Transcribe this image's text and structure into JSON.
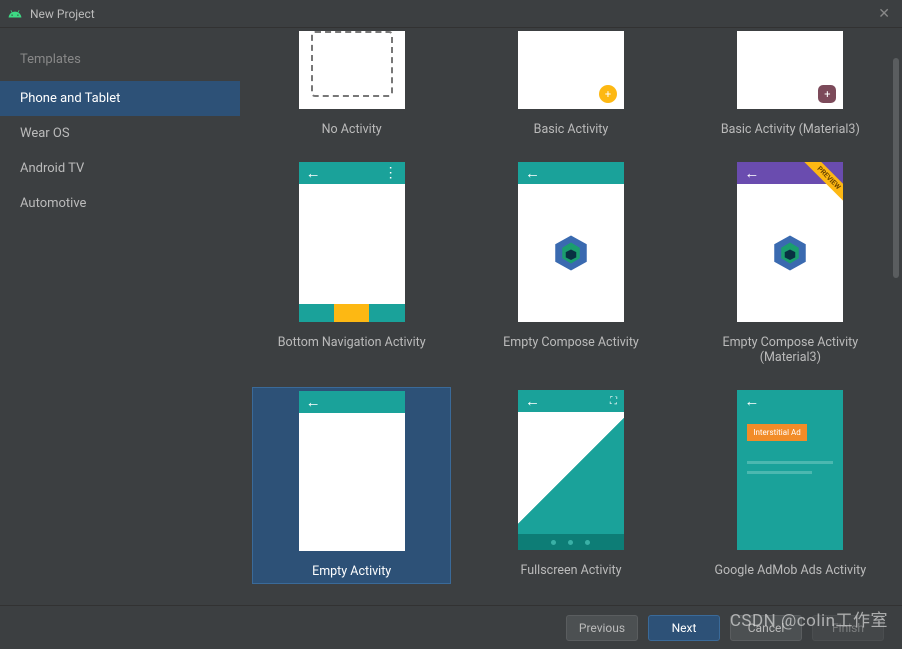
{
  "window": {
    "title": "New Project"
  },
  "sidebar": {
    "header": "Templates",
    "items": [
      {
        "label": "Phone and Tablet",
        "selected": true
      },
      {
        "label": "Wear OS",
        "selected": false
      },
      {
        "label": "Android TV",
        "selected": false
      },
      {
        "label": "Automotive",
        "selected": false
      }
    ]
  },
  "templates": {
    "row0": [
      {
        "label": "No Activity"
      },
      {
        "label": "Basic Activity"
      },
      {
        "label": "Basic Activity (Material3)"
      }
    ],
    "row1": [
      {
        "label": "Bottom Navigation Activity"
      },
      {
        "label": "Empty Compose Activity"
      },
      {
        "label": "Empty Compose Activity (Material3)",
        "ribbon": "PREVIEW"
      }
    ],
    "row2": [
      {
        "label": "Empty Activity",
        "selected": true
      },
      {
        "label": "Fullscreen Activity"
      },
      {
        "label": "Google AdMob Ads Activity",
        "adText": "Interstitial Ad"
      }
    ]
  },
  "footer": {
    "previous": "Previous",
    "next": "Next",
    "cancel": "Cancel",
    "finish": "Finish"
  },
  "watermark": "CSDN @colin工作室"
}
